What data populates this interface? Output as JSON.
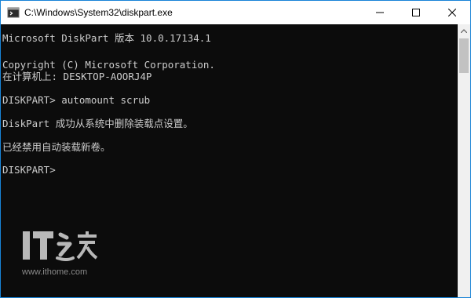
{
  "window": {
    "title": "C:\\Windows\\System32\\diskpart.exe",
    "app_icon": "console-app-icon",
    "controls": {
      "minimize_icon": "minimize-icon",
      "maximize_icon": "maximize-icon",
      "close_icon": "close-icon"
    }
  },
  "console": {
    "lines": [
      "Microsoft DiskPart 版本 10.0.17134.1",
      "Copyright (C) Microsoft Corporation.",
      "在计算机上: DESKTOP-AOORJ4P",
      "DISKPART> automount scrub",
      "DiskPart 成功从系统中删除装载点设置。",
      "已经禁用自动装载新卷。",
      "DISKPART>"
    ],
    "text_color": "#cccccc",
    "background_color": "#0c0c0c"
  },
  "scrollbar": {
    "up_icon": "scroll-up-arrow-icon"
  },
  "watermark": {
    "logo_text": "IT之家",
    "url": "www.ithome.com"
  }
}
